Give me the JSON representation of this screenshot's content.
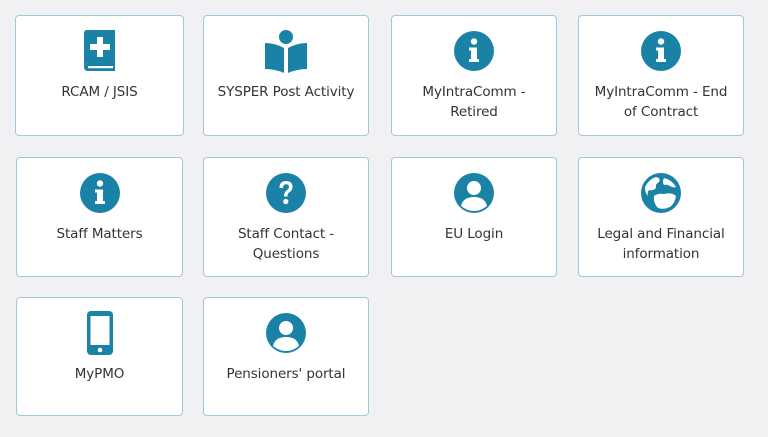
{
  "accent_color": "#1a82a6",
  "tiles": [
    {
      "label": "RCAM / JSIS",
      "icon": "medical-book-icon"
    },
    {
      "label": "SYSPER Post Activity",
      "icon": "reader-icon"
    },
    {
      "label": "MyIntraComm - Retired",
      "icon": "info-icon"
    },
    {
      "label": "MyIntraComm - End of Contract",
      "icon": "info-icon"
    },
    {
      "label": "Staff Matters",
      "icon": "info-icon"
    },
    {
      "label": "Staff Contact - Questions",
      "icon": "question-icon"
    },
    {
      "label": "EU Login",
      "icon": "user-icon"
    },
    {
      "label": "Legal and Financial information",
      "icon": "globe-icon"
    },
    {
      "label": "MyPMO",
      "icon": "mobile-phone-icon"
    },
    {
      "label": "Pensioners' portal",
      "icon": "user-icon"
    }
  ]
}
